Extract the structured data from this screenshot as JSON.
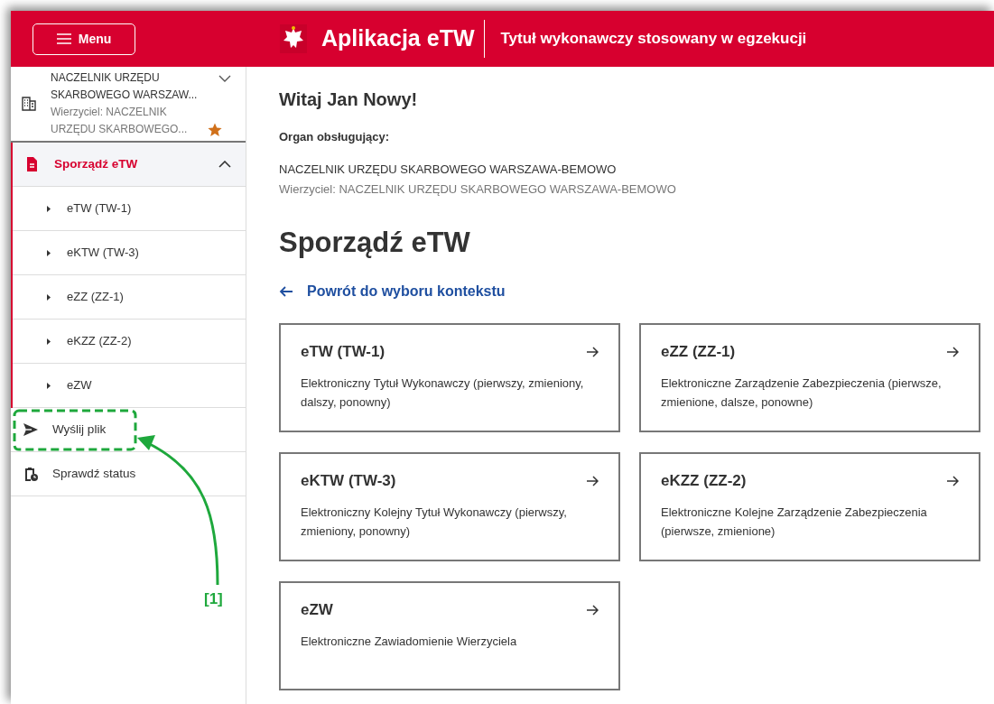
{
  "header": {
    "menu_button": "Menu",
    "app_title": "Aplikacja eTW",
    "subtitle": "Tytuł wykonawczy stosowany w egzekucji"
  },
  "sidebar": {
    "context": {
      "name": "NACZELNIK URZĘDU SKARBOWEGO WARSZAW...",
      "creditor": "Wierzyciel: NACZELNIK URZĘDU SKARBOWEGO...",
      "favorite": true,
      "expanded": false
    },
    "items": [
      {
        "kind": "group",
        "label": "Sporządź eTW",
        "selected": true,
        "expanded": true,
        "children": [
          {
            "label": "eTW (TW-1)"
          },
          {
            "label": "eKTW (TW-3)"
          },
          {
            "label": "eZZ (ZZ-1)"
          },
          {
            "label": "eKZZ (ZZ-2)"
          },
          {
            "label": "eZW"
          }
        ]
      },
      {
        "kind": "send",
        "label": "Wyślij plik",
        "selected": false
      },
      {
        "kind": "status",
        "label": "Sprawdź status",
        "selected": false
      }
    ]
  },
  "main": {
    "greeting": "Witaj Jan Nowy!",
    "organ_label": "Organ obsługujący:",
    "organ_name": "NACZELNIK URZĘDU SKARBOWEGO WARSZAWA-BEMOWO",
    "organ_creditor": "Wierzyciel: NACZELNIK URZĘDU SKARBOWEGO WARSZAWA-BEMOWO",
    "heading": "Sporządź eTW",
    "back_link": "Powrót do wyboru kontekstu",
    "cards": [
      {
        "title": "eTW (TW-1)",
        "description": "Elektroniczny Tytuł Wykonawczy (pierwszy, zmieniony, dalszy, ponowny)"
      },
      {
        "title": "eZZ (ZZ-1)",
        "description": "Elektroniczne Zarządzenie Zabezpieczenia (pierwsze, zmienione, dalsze, ponowne)"
      },
      {
        "title": "eKTW (TW-3)",
        "description": "Elektroniczny Kolejny Tytuł Wykonawczy (pierwszy, zmieniony, ponowny)"
      },
      {
        "title": "eKZZ (ZZ-2)",
        "description": "Elektroniczne Kolejne Zarządzenie Zabezpieczenia (pierwsze, zmienione)"
      },
      {
        "title": "eZW",
        "description": "Elektroniczne Zawiadomienie Wierzyciela"
      }
    ]
  },
  "annotation": {
    "label": "[1]"
  }
}
